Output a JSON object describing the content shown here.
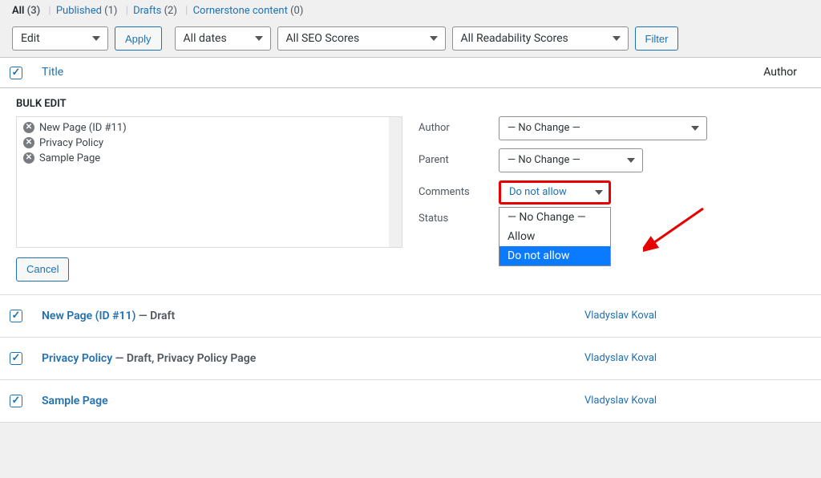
{
  "subsubsub": {
    "all_label": "All",
    "all_count": "(3)",
    "published_label": "Published",
    "published_count": "(1)",
    "drafts_label": "Drafts",
    "drafts_count": "(2)",
    "cornerstone_label": "Cornerstone content",
    "cornerstone_count": "(0)"
  },
  "filters": {
    "bulk_action": "Edit",
    "apply_label": "Apply",
    "date": "All dates",
    "seo": "All SEO Scores",
    "readability": "All Readability Scores",
    "filter_label": "Filter"
  },
  "columns": {
    "title": "Title",
    "author": "Author"
  },
  "bulk_edit": {
    "heading": "BULK EDIT",
    "items": [
      {
        "label": "New Page (ID #11)"
      },
      {
        "label": "Privacy Policy"
      },
      {
        "label": "Sample Page"
      }
    ],
    "fields": {
      "author_label": "Author",
      "author_value": "— No Change —",
      "parent_label": "Parent",
      "parent_value": "— No Change —",
      "comments_label": "Comments",
      "comments_value": "Do not allow",
      "status_label": "Status"
    },
    "dropdown_options": {
      "opt1": "— No Change —",
      "opt2": "Allow",
      "opt3": "Do not allow"
    },
    "cancel_label": "Cancel"
  },
  "pages": [
    {
      "title": "New Page (ID #11)",
      "state": " — Draft",
      "author": "Vladyslav Koval"
    },
    {
      "title": "Privacy Policy",
      "state": " — Draft, Privacy Policy Page",
      "author": "Vladyslav Koval"
    },
    {
      "title": "Sample Page",
      "state": "",
      "author": "Vladyslav Koval"
    }
  ]
}
